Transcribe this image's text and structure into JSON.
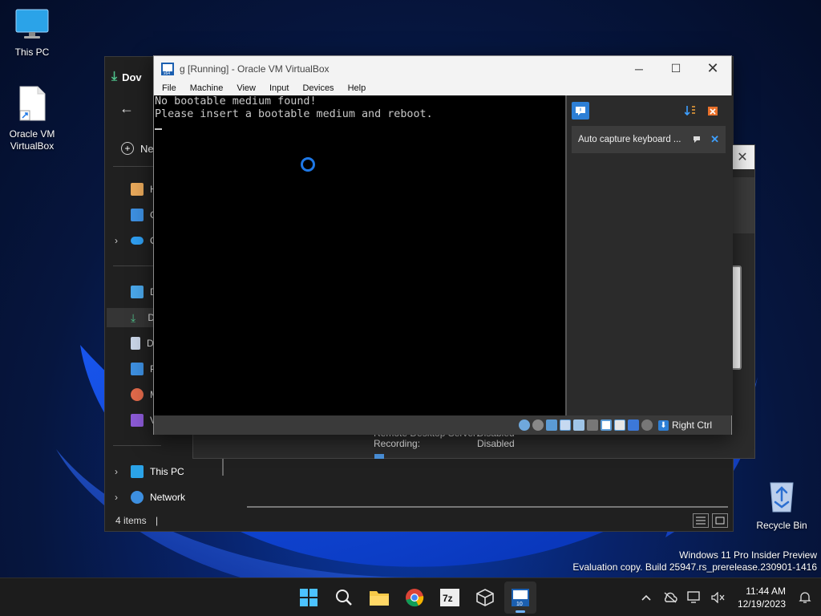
{
  "desktop": {
    "icons": [
      {
        "label": "This PC"
      },
      {
        "label": "Oracle VM\nVirtualBox"
      },
      {
        "label": "Recycle Bin"
      }
    ],
    "watermark": {
      "line1": "Windows 11 Pro Insider Preview",
      "line2": "Evaluation copy. Build 25947.rs_prerelease.230901-1416"
    }
  },
  "explorer": {
    "tab_label": "Dov",
    "new_label": "Nev",
    "nav_items": [
      {
        "label": "H",
        "icon": "home-icon"
      },
      {
        "label": "G",
        "icon": "gallery-icon"
      },
      {
        "label": "O",
        "icon": "onedrive-icon"
      },
      {
        "label": "D",
        "icon": "desktop-icon"
      },
      {
        "label": "D",
        "icon": "downloads-icon"
      },
      {
        "label": "D",
        "icon": "documents-icon"
      },
      {
        "label": "P",
        "icon": "pictures-icon"
      },
      {
        "label": "M",
        "icon": "music-icon"
      },
      {
        "label": "V",
        "icon": "videos-icon"
      }
    ],
    "this_pc": "This PC",
    "network": "Network",
    "status": "4 items",
    "status_sep": "|"
  },
  "settings_fragment": {
    "rows": [
      {
        "label": "Remote Desktop Server:",
        "value": "Disabled"
      },
      {
        "label": "Recording:",
        "value": "Disabled"
      }
    ]
  },
  "vbox": {
    "title": "g [Running] - Oracle VM VirtualBox",
    "menu": [
      "File",
      "Machine",
      "View",
      "Input",
      "Devices",
      "Help"
    ],
    "screen_lines": [
      "No bootable medium found!",
      "Please insert a bootable medium and reboot."
    ],
    "notice": "Auto capture keyboard ...",
    "host_key": "Right Ctrl"
  },
  "taskbar": {
    "time": "11:44 AM",
    "date": "12/19/2023"
  },
  "colors": {
    "accent": "#1e78e6",
    "taskbar": "#1c1c1c",
    "explorer_bg": "#202020"
  }
}
